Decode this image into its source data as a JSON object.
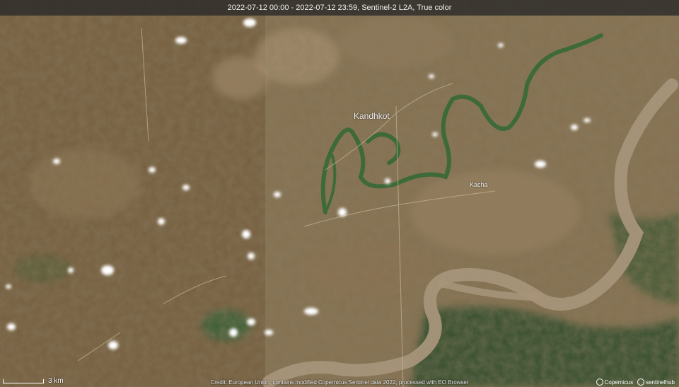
{
  "header": {
    "caption": "2022-07-12 00:00 - 2022-07-12 23:59, Sentinel-2 L2A, True color"
  },
  "labels": {
    "city": "Kandhkot",
    "town": "Kacha"
  },
  "scale": {
    "label": "3 km"
  },
  "footer": {
    "attribution": "Credit: European Union, contains modified Copernicus Sentinel data 2022, processed with EO Browser"
  },
  "logos": {
    "copernicus": "Copernicus",
    "sentinelhub": "sentinelhub"
  },
  "colors": {
    "terrain_brown": "#7a6443",
    "terrain_light": "#a3886a",
    "vegetation_dark": "#33492b",
    "vegetation_green": "#3f5e32",
    "river_silt": "#a6957a",
    "channel_green": "#3e6a3a",
    "cloud": "#ffffff"
  }
}
